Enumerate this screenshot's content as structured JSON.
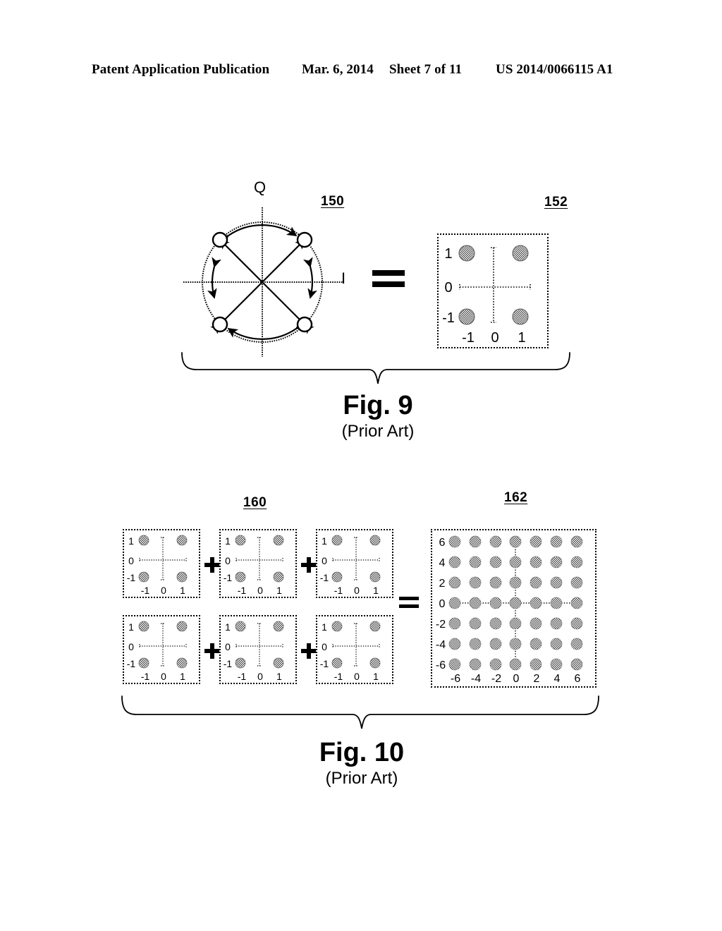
{
  "header": {
    "publication": "Patent Application Publication",
    "date": "Mar. 6, 2014",
    "sheet": "Sheet 7 of 11",
    "patent_number": "US 2014/0066115 A1"
  },
  "figures": [
    {
      "id": "fig9",
      "title": "Fig. 9",
      "subtitle": "(Prior Art)",
      "refs": {
        "constellation": "150",
        "scatter": "152"
      },
      "constellation": {
        "axis_q_label": "Q",
        "axis_i_label": "I",
        "points": [
          {
            "angle_deg": 45,
            "label": ""
          },
          {
            "angle_deg": 135,
            "label": ""
          },
          {
            "angle_deg": 225,
            "label": ""
          },
          {
            "angle_deg": 315,
            "label": ""
          }
        ]
      },
      "operator": "=",
      "scatter": {
        "x_ticks": [
          "-1",
          "0",
          "1"
        ],
        "y_ticks": [
          "1",
          "0",
          "-1"
        ],
        "points": [
          {
            "x": -1,
            "y": 1
          },
          {
            "x": 1,
            "y": 1
          },
          {
            "x": -1,
            "y": -1
          },
          {
            "x": 1,
            "y": -1
          }
        ]
      }
    },
    {
      "id": "fig10",
      "title": "Fig. 10",
      "subtitle": "(Prior Art)",
      "refs": {
        "addends": "160",
        "result": "162"
      },
      "operators": {
        "plus": "+",
        "equals": "="
      },
      "addend_count": 6,
      "addend": {
        "x_ticks": [
          "-1",
          "0",
          "1"
        ],
        "y_ticks": [
          "1",
          "0",
          "-1"
        ],
        "points": [
          {
            "x": -1,
            "y": 1
          },
          {
            "x": 1,
            "y": 1
          },
          {
            "x": -1,
            "y": -1
          },
          {
            "x": 1,
            "y": -1
          }
        ]
      },
      "result": {
        "x_ticks": [
          "-6",
          "-4",
          "-2",
          "0",
          "2",
          "4",
          "6"
        ],
        "y_ticks": [
          "6",
          "4",
          "2",
          "0",
          "-2",
          "-4",
          "-6"
        ],
        "grid_x": [
          -6,
          -4,
          -2,
          0,
          2,
          4,
          6
        ],
        "grid_y": [
          6,
          4,
          2,
          0,
          -2,
          -4,
          -6
        ]
      }
    }
  ],
  "chart_data": [
    {
      "type": "scatter",
      "title": "152",
      "xlabel": "I",
      "ylabel": "Q",
      "x": [
        -1,
        1,
        -1,
        1
      ],
      "y": [
        1,
        1,
        -1,
        -1
      ],
      "xticks": [
        -1,
        0,
        1
      ],
      "yticks": [
        -1,
        0,
        1
      ],
      "xlim": [
        -1.6,
        1.6
      ],
      "ylim": [
        -1.6,
        1.6
      ],
      "grid": true,
      "legend": "none"
    },
    {
      "type": "scatter",
      "title": "160 (addend, x6)",
      "xlabel": "",
      "ylabel": "",
      "x": [
        -1,
        1,
        -1,
        1
      ],
      "y": [
        1,
        1,
        -1,
        -1
      ],
      "xticks": [
        -1,
        0,
        1
      ],
      "yticks": [
        -1,
        0,
        1
      ],
      "xlim": [
        -1.6,
        1.6
      ],
      "ylim": [
        -1.6,
        1.6
      ],
      "grid": true,
      "legend": "none"
    },
    {
      "type": "scatter",
      "title": "162 (sum of six 4-QAM constellations)",
      "xlabel": "",
      "ylabel": "",
      "x": [
        -6,
        -4,
        -2,
        0,
        2,
        4,
        6,
        -6,
        -4,
        -2,
        0,
        2,
        4,
        6,
        -6,
        -4,
        -2,
        0,
        2,
        4,
        6,
        -6,
        -4,
        -2,
        0,
        2,
        4,
        6,
        -6,
        -4,
        -2,
        0,
        2,
        4,
        6,
        -6,
        -4,
        -2,
        0,
        2,
        4,
        6,
        -6,
        -4,
        -2,
        0,
        2,
        4,
        6
      ],
      "y": [
        6,
        6,
        6,
        6,
        6,
        6,
        6,
        4,
        4,
        4,
        4,
        4,
        4,
        4,
        2,
        2,
        2,
        2,
        2,
        2,
        2,
        0,
        0,
        0,
        0,
        0,
        0,
        0,
        -2,
        -2,
        -2,
        -2,
        -2,
        -2,
        -2,
        -4,
        -4,
        -4,
        -4,
        -4,
        -4,
        -4,
        -6,
        -6,
        -6,
        -6,
        -6,
        -6,
        -6
      ],
      "xticks": [
        -6,
        -4,
        -2,
        0,
        2,
        4,
        6
      ],
      "yticks": [
        -6,
        -4,
        -2,
        0,
        2,
        4,
        6
      ],
      "xlim": [
        -7.6,
        7.6
      ],
      "ylim": [
        -7.6,
        7.6
      ],
      "grid": true,
      "legend": "none"
    }
  ]
}
